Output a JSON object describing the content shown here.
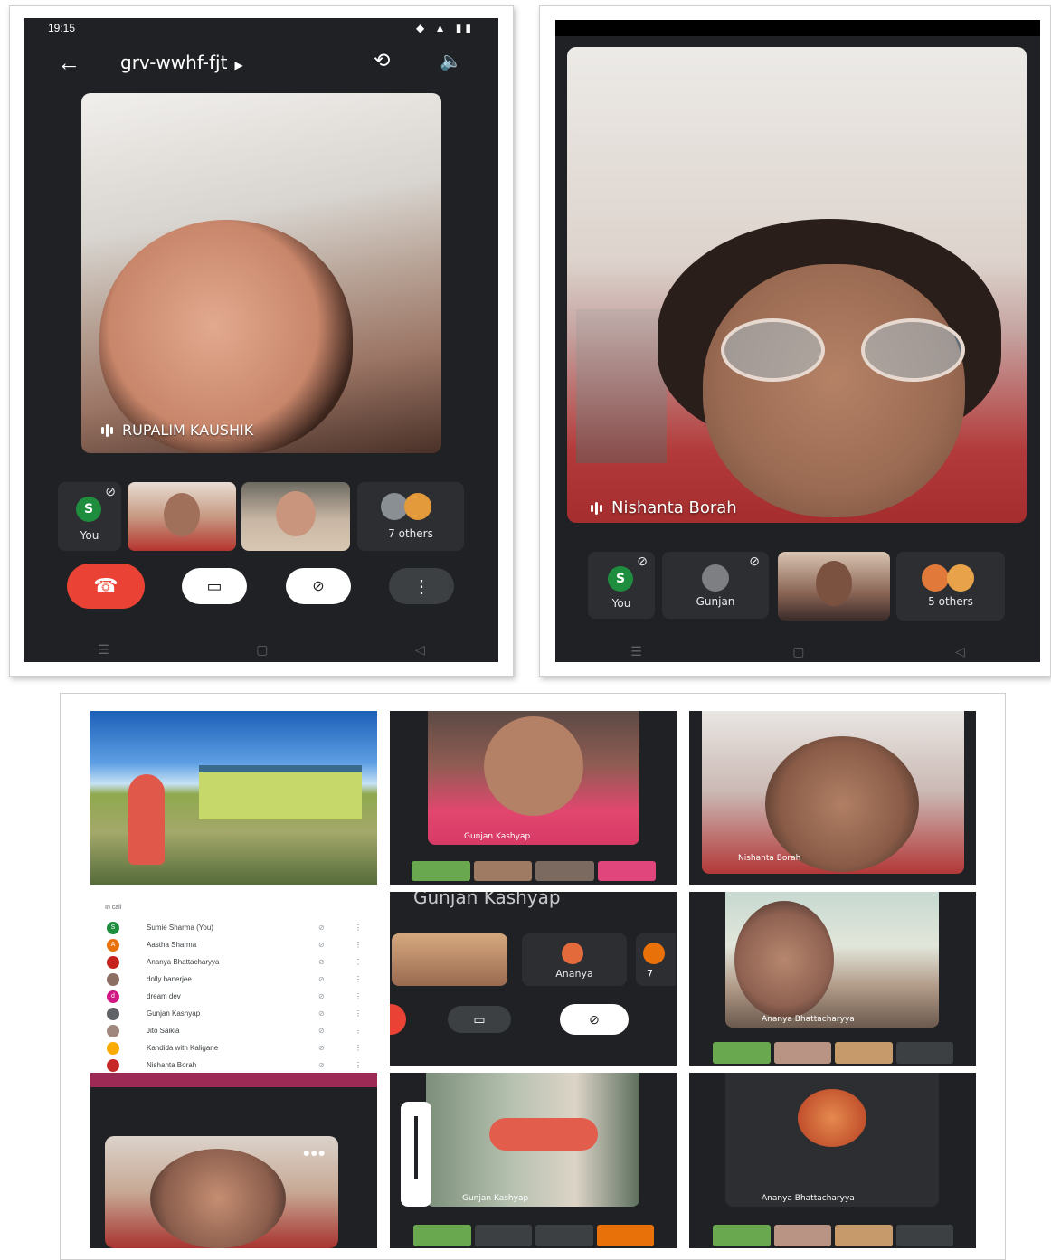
{
  "phone1": {
    "status": {
      "time": "19:15"
    },
    "header": {
      "meeting_code": "grv-wwhf-fjt"
    },
    "main_tile": {
      "name": "RUPALIM KAUSHIK"
    },
    "strip": [
      {
        "label": "You",
        "avatar_letter": "S"
      },
      {
        "label": ""
      },
      {
        "label": ""
      },
      {
        "label": "7 others"
      }
    ]
  },
  "phone2": {
    "main_tile": {
      "name": "Nishanta Borah"
    },
    "strip": [
      {
        "label": "You",
        "avatar_letter": "S"
      },
      {
        "label": "Gunjan"
      },
      {
        "label": ""
      },
      {
        "label": "5 others"
      }
    ]
  },
  "collage": {
    "tile2": {
      "name": "Gunjan Kashyap"
    },
    "tile3": {
      "name": "Nishanta Borah"
    },
    "tile5": {
      "header_name": "Gunjan Kashyap",
      "participant": "Ananya",
      "overflow": "7"
    },
    "tile6": {
      "name": "Ananya Bhattacharyya"
    },
    "tile8": {
      "name": "Gunjan Kashyap"
    },
    "tile9": {
      "name": "Ananya Bhattacharyya"
    },
    "people_list": {
      "heading": "In call",
      "people": [
        {
          "name": "Sumie Sharma (You)",
          "color": "#1e8e3e",
          "letter": "S"
        },
        {
          "name": "Aastha Sharma",
          "color": "#e8710a",
          "letter": "A"
        },
        {
          "name": "Ananya Bhattacharyya",
          "color": "#c5221f",
          "letter": ""
        },
        {
          "name": "dolly banerjee",
          "color": "#8d6e63",
          "letter": ""
        },
        {
          "name": "dream dev",
          "color": "#d01884",
          "letter": "d"
        },
        {
          "name": "Gunjan Kashyap",
          "color": "#5f6368",
          "letter": ""
        },
        {
          "name": "Jito Saikia",
          "color": "#a1887f",
          "letter": ""
        },
        {
          "name": "Kandida with Kaligane",
          "color": "#f9ab00",
          "letter": ""
        },
        {
          "name": "Nishanta Borah",
          "color": "#c62828",
          "letter": ""
        }
      ]
    }
  }
}
